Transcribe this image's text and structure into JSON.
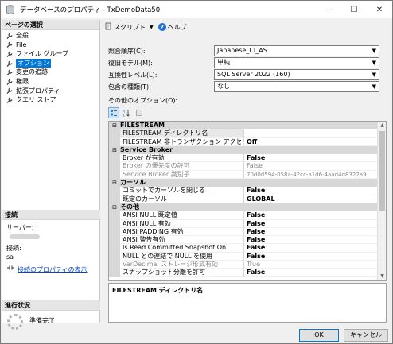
{
  "window": {
    "title": "データベースのプロパティ - TxDemoData50"
  },
  "left": {
    "page_header": "ページの選択",
    "pages": [
      {
        "label": "全般",
        "selected": false
      },
      {
        "label": "File",
        "selected": false
      },
      {
        "label": "ファイル グループ",
        "selected": false
      },
      {
        "label": "オプション",
        "selected": true
      },
      {
        "label": "変更の追跡",
        "selected": false
      },
      {
        "label": "権限",
        "selected": false
      },
      {
        "label": "拡張プロパティ",
        "selected": false
      },
      {
        "label": "クエリ ストア",
        "selected": false
      }
    ],
    "connection_header": "接続",
    "server_label": "サーバー:",
    "connection_label": "接続:",
    "connection_user": "sa",
    "view_conn_props": "接続のプロパティの表示",
    "progress_header": "進行状況",
    "progress_status": "準備完了"
  },
  "toolbar": {
    "script_label": "スクリプト",
    "help_label": "ヘルプ"
  },
  "form": {
    "collation_label": "照合順序(C):",
    "collation_value": "Japanese_CI_AS",
    "recovery_label": "復旧モデル(M):",
    "recovery_value": "単純",
    "compat_label": "互換性レベル(L):",
    "compat_value": "SQL Server 2022 (160)",
    "containment_label": "包含の種類(T):",
    "containment_value": "なし",
    "other_label": "その他のオプション(O):"
  },
  "grid": {
    "cat_filestream": "FILESTREAM",
    "fs_dir_name": "FILESTREAM ディレクトリ名",
    "fs_dir_value": "",
    "fs_nontx_name": "FILESTREAM 非トランザクション アクセス",
    "fs_nontx_value": "Off",
    "cat_broker": "Service Broker",
    "sb_enabled_name": "Broker が有効",
    "sb_enabled_value": "False",
    "sb_priority_name": "Broker の優先度の許可",
    "sb_priority_value": "False",
    "sb_id_name": "Service Broker 識別子",
    "sb_id_value": "70d0d594-058a-42cc-a1d6-4aad4d8322a9",
    "cat_cursor": "カーソル",
    "cur_close_name": "コミットでカーソルを閉じる",
    "cur_close_value": "False",
    "cur_default_name": "既定のカーソル",
    "cur_default_value": "GLOBAL",
    "cat_misc": "その他",
    "misc1_name": "ANSI NULL 既定値",
    "misc1_value": "False",
    "misc2_name": "ANSI NULL 有効",
    "misc2_value": "False",
    "misc3_name": "ANSI PADDING 有効",
    "misc3_value": "False",
    "misc4_name": "ANSI 警告有効",
    "misc4_value": "False",
    "misc5_name": "Is Read Committed Snapshot On",
    "misc5_value": "False",
    "misc6_name": "NULL との連結で NULL を使用",
    "misc6_value": "False",
    "misc7_name": "VarDecimal ストレージ形式有効",
    "misc7_value": "True",
    "misc8_name": "スナップショット分離を許可",
    "misc8_value": "False"
  },
  "description": "FILESTREAM ディレクトリ名",
  "buttons": {
    "ok": "OK",
    "cancel": "キャンセル"
  }
}
